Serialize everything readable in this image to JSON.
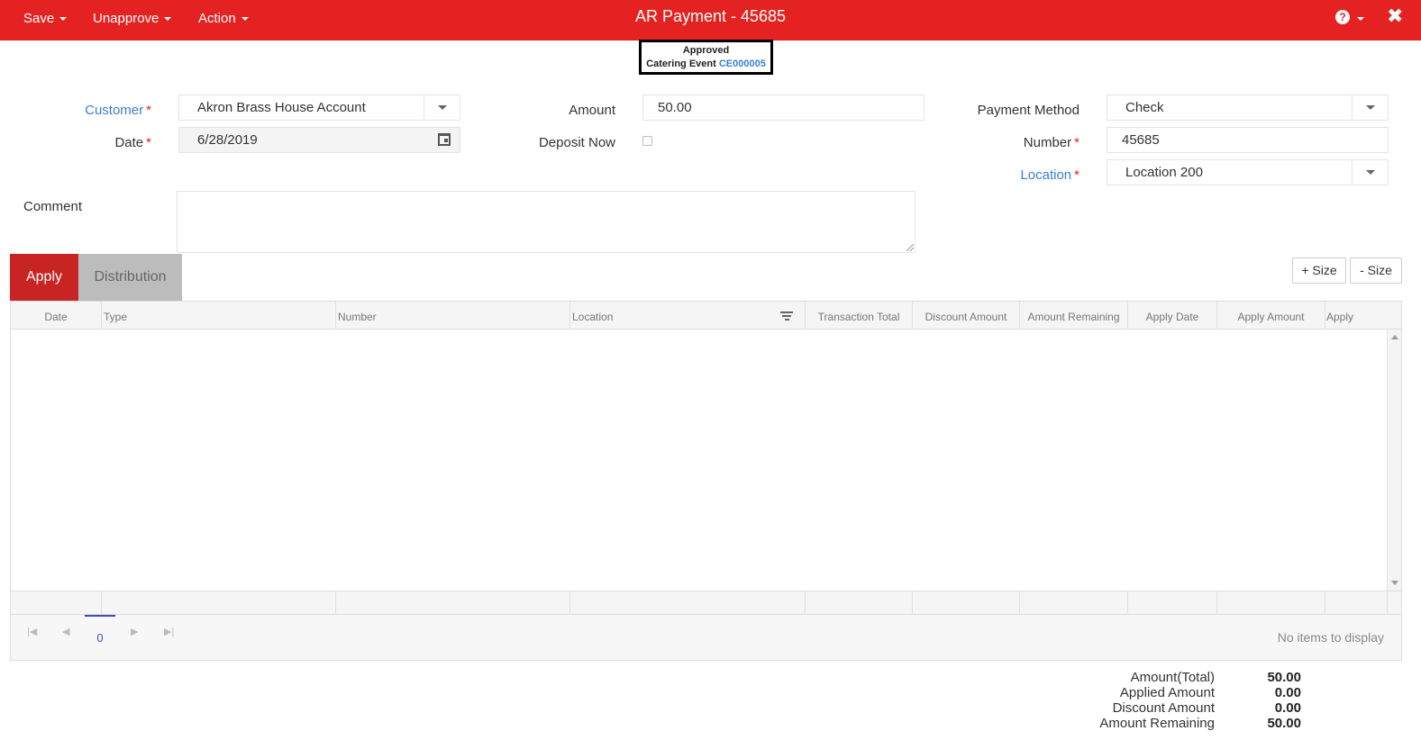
{
  "toolbar": {
    "save_label": "Save",
    "unapprove_label": "Unapprove",
    "action_label": "Action",
    "title": "AR Payment - 45685",
    "help_icon": "question-circle-icon",
    "close_icon": "close-icon"
  },
  "status": {
    "state": "Approved",
    "ref_label": "Catering Event",
    "ref_link": "CE000005"
  },
  "form": {
    "customer": {
      "label": "Customer",
      "required": "*",
      "value": "Akron Brass House Account"
    },
    "date": {
      "label": "Date",
      "required": "*",
      "value": "6/28/2019"
    },
    "amount": {
      "label": "Amount",
      "value": "50.00"
    },
    "deposit_now": {
      "label": "Deposit Now",
      "checked": false
    },
    "payment_method": {
      "label": "Payment Method",
      "value": "Check"
    },
    "number": {
      "label": "Number",
      "required": "*",
      "value": "45685"
    },
    "location": {
      "label": "Location",
      "required": "*",
      "value": "Location 200"
    },
    "comment": {
      "label": "Comment",
      "value": ""
    }
  },
  "tabs": [
    {
      "label": "Apply",
      "active": true
    },
    {
      "label": "Distribution",
      "active": false
    }
  ],
  "size_buttons": {
    "plus": "+ Size",
    "minus": "- Size"
  },
  "grid": {
    "columns": [
      "Date",
      "Type",
      "Number",
      "Location",
      "Transaction Total",
      "Discount Amount",
      "Amount Remaining",
      "Apply Date",
      "Apply Amount",
      "Apply"
    ],
    "rows": [],
    "pager": {
      "page": "0",
      "empty_text": "No items to display"
    }
  },
  "totals": [
    {
      "label": "Amount(Total)",
      "value": "50.00"
    },
    {
      "label": "Applied Amount",
      "value": "0.00"
    },
    {
      "label": "Discount Amount",
      "value": "0.00"
    },
    {
      "label": "Amount Remaining",
      "value": "50.00"
    }
  ],
  "colors": {
    "brand_red": "#e42222",
    "tab_active": "#c92424",
    "link_blue": "#3a7fd0"
  }
}
